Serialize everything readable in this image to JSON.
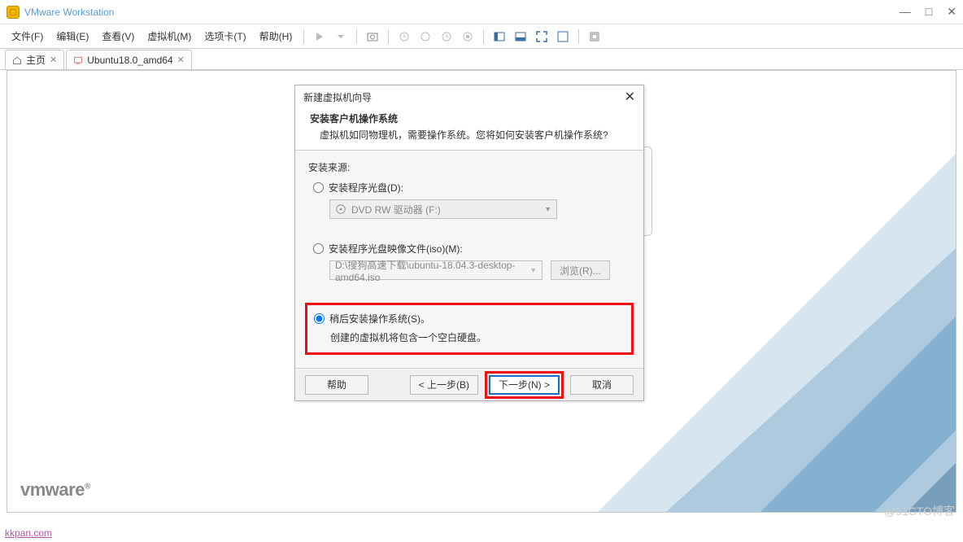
{
  "window": {
    "title": "VMware Workstation",
    "controls": {
      "min": "—",
      "max": "□",
      "close": "✕"
    }
  },
  "menu": {
    "items": [
      "文件(F)",
      "编辑(E)",
      "查看(V)",
      "虚拟机(M)",
      "选项卡(T)",
      "帮助(H)"
    ]
  },
  "tabs": {
    "home": "主页",
    "vm": "Ubuntu18.0_amd64"
  },
  "dialog": {
    "title": "新建虚拟机向导",
    "heading": "安装客户机操作系统",
    "subheading": "虚拟机如同物理机，需要操作系统。您将如何安装客户机操作系统?",
    "source_label": "安装来源:",
    "opt_disc": "安装程序光盘(D):",
    "disc_value": "DVD RW 驱动器 (F:)",
    "opt_iso": "安装程序光盘映像文件(iso)(M):",
    "iso_path": "D:\\搜狗高速下载\\ubuntu-18.04.3-desktop-amd64.iso",
    "browse": "浏览(R)...",
    "opt_later": "稍后安装操作系统(S)。",
    "opt_later_desc": "创建的虚拟机将包含一个空白硬盘。",
    "btn_help": "帮助",
    "btn_back": "< 上一步(B)",
    "btn_next": "下一步(N) >",
    "btn_cancel": "取消"
  },
  "logo": "vmware",
  "bottom_link": "kkpan.com",
  "watermark": "@51CTO博客"
}
